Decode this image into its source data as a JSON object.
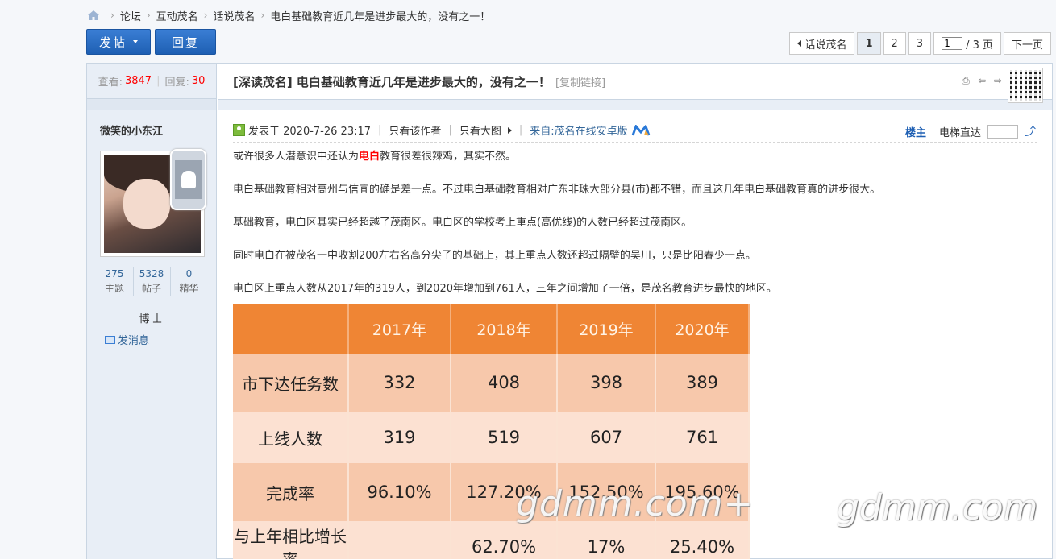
{
  "breadcrumb": {
    "items": [
      "论坛",
      "互动茂名",
      "话说茂名",
      "电白基础教育近几年是进步最大的，没有之一！"
    ]
  },
  "buttons": {
    "post": "发帖",
    "reply": "回复"
  },
  "pager": {
    "prev_label": "话说茂名",
    "pages": [
      "1",
      "2",
      "3"
    ],
    "current_page": "1",
    "input_value": "1",
    "total_label": "/ 3 页",
    "next_label": "下一页"
  },
  "sidebar": {
    "views_label": "查看:",
    "views": "3847",
    "replies_label": "回复:",
    "replies": "30",
    "author": "微笑的小东江",
    "stats": [
      {
        "value": "275",
        "label": "主题"
      },
      {
        "value": "5328",
        "label": "帖子"
      },
      {
        "value": "0",
        "label": "精华"
      }
    ],
    "rank": "博士",
    "send_message": "发消息"
  },
  "post": {
    "title": "[深读茂名] 电白基础教育近几年是进步最大的，没有之一！",
    "copy_link": "[复制链接]",
    "posted_at": "发表于 2020-7-26 23:17",
    "author_only": "只看该作者",
    "big_image": "只看大图",
    "source": "来自:茂名在线安卓版",
    "floor": "楼主",
    "elevator": "电梯直达",
    "paragraphs": {
      "p1_a": "或许很多人潜意识中还认为",
      "p1_red": "电白",
      "p1_b": "教育很差很辣鸡，其实不然。",
      "p2": "电白基础教育相对高州与信宜的确是差一点。不过电白基础教育相对广东非珠大部分县(市)都不错，而且这几年电白基础教育真的进步很大。",
      "p3": "基础教育，电白区其实已经超越了茂南区。电白区的学校考上重点(高优线)的人数已经超过茂南区。",
      "p4": "同时电白在被茂名一中收割200左右名高分尖子的基础上，其上重点人数还超过隔壁的吴川，只是比阳春少一点。",
      "p5": "电白区上重点人数从2017年的319人，到2020年增加到761人，三年之间增加了一倍，是茂名教育进步最快的地区。"
    }
  },
  "table": {
    "headers": [
      "",
      "2017年",
      "2018年",
      "2019年",
      "2020年"
    ],
    "rows": [
      [
        "市下达任务数",
        "332",
        "408",
        "398",
        "389"
      ],
      [
        "上线人数",
        "319",
        "519",
        "607",
        "761"
      ],
      [
        "完成率",
        "96.10%",
        "127.20%",
        "152.50%",
        "195.60%"
      ],
      [
        "与上年相比增长率",
        "",
        "62.70%",
        "17%",
        "25.40%"
      ]
    ]
  },
  "watermarks": {
    "left": "gdmm.com+",
    "right": "gdmm.com"
  },
  "colors": {
    "accent": "#1e5fb3",
    "red": "#ff0000",
    "table_header": "#ef8534"
  }
}
